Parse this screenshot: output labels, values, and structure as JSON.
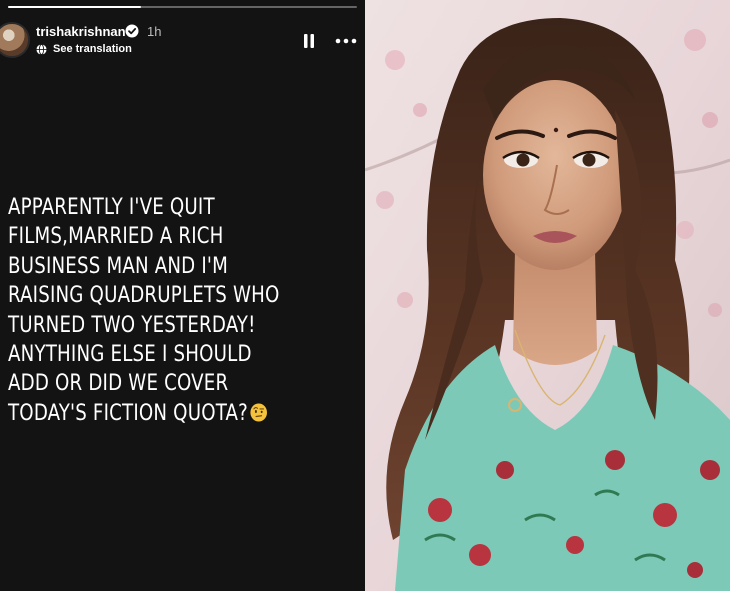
{
  "story": {
    "username": "trishakrishnan",
    "time": "1h",
    "translation_label": "See translation",
    "progress": 0.38,
    "lines": [
      "APPARENTLY I'VE QUIT",
      "FILMS,MARRIED A RICH",
      "BUSINESS MAN AND I'M",
      "RAISING QUADRUPLETS WHO",
      "TURNED TWO YESTERDAY!",
      "ANYTHING ELSE I SHOULD",
      "ADD OR DID WE COVER",
      "TODAY'S FICTION QUOTA?"
    ],
    "emoji": "face-with-raised-eyebrow"
  },
  "colors": {
    "story_bg": "#131313",
    "dress": "#7cc9b8",
    "background_blossom": "#e9d3d8"
  }
}
